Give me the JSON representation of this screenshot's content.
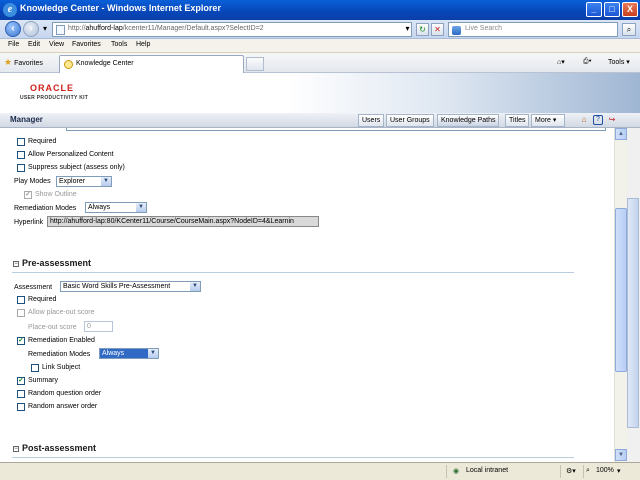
{
  "window": {
    "title": "Knowledge Center - Windows Internet Explorer",
    "minimize": "_",
    "maximize": "□",
    "close": "X"
  },
  "addressbar": {
    "url_prefix": "http://",
    "url_host": "ahufford-lap",
    "url_path": "/kcenter11/Manager/Default.aspx?SelectID=2",
    "search_placeholder": "Live Search"
  },
  "menu": {
    "items": [
      "File",
      "Edit",
      "View",
      "Favorites",
      "Tools",
      "Help"
    ]
  },
  "favbar": {
    "favorites_label": "Favorites",
    "tab_title": "Knowledge Center",
    "tools_label": "Tools"
  },
  "header": {
    "logo_top": "ORACLE",
    "logo_sub": "USER PRODUCTIVITY KIT"
  },
  "manager": {
    "title": "Manager",
    "nav": [
      "Users",
      "User Groups",
      "Knowledge Paths",
      "Titles",
      "More"
    ]
  },
  "form": {
    "required_label": "Required",
    "required_checked": false,
    "allow_personalized_label": "Allow Personalized Content",
    "allow_personalized_checked": false,
    "suppress_subject_label": "Suppress subject (assess only)",
    "suppress_subject_checked": false,
    "play_modes_label": "Play Modes",
    "play_modes_value": "Explorer",
    "show_outline_label": "Show Outline",
    "show_outline_checked": true,
    "remediation_modes_label": "Remediation Modes",
    "remediation_modes_value": "Always",
    "hyperlink_label": "Hyperlink",
    "hyperlink_value": "http://ahufford-lap:80/KCenter11/Course/CourseMain.aspx?NodeID=4&Learnin"
  },
  "pre_assessment": {
    "heading": "Pre-assessment",
    "assessment_label": "Assessment",
    "assessment_value": "Basic Word Skills Pre-Assessment",
    "required_label": "Required",
    "required_checked": false,
    "allow_placeout_label": "Allow place-out score",
    "allow_placeout_checked": false,
    "placeout_score_label": "Place-out score",
    "placeout_score_value": "0",
    "remediation_enabled_label": "Remediation Enabled",
    "remediation_enabled_checked": true,
    "remediation_modes_label": "Remediation Modes",
    "remediation_modes_value": "Always",
    "link_subject_label": "Link Subject",
    "link_subject_checked": false,
    "summary_label": "Summary",
    "summary_checked": true,
    "random_question_label": "Random question order",
    "random_question_checked": false,
    "random_answer_label": "Random answer order",
    "random_answer_checked": false
  },
  "post_assessment": {
    "heading": "Post-assessment"
  },
  "status": {
    "zone": "Local intranet",
    "zoom": "100%"
  }
}
